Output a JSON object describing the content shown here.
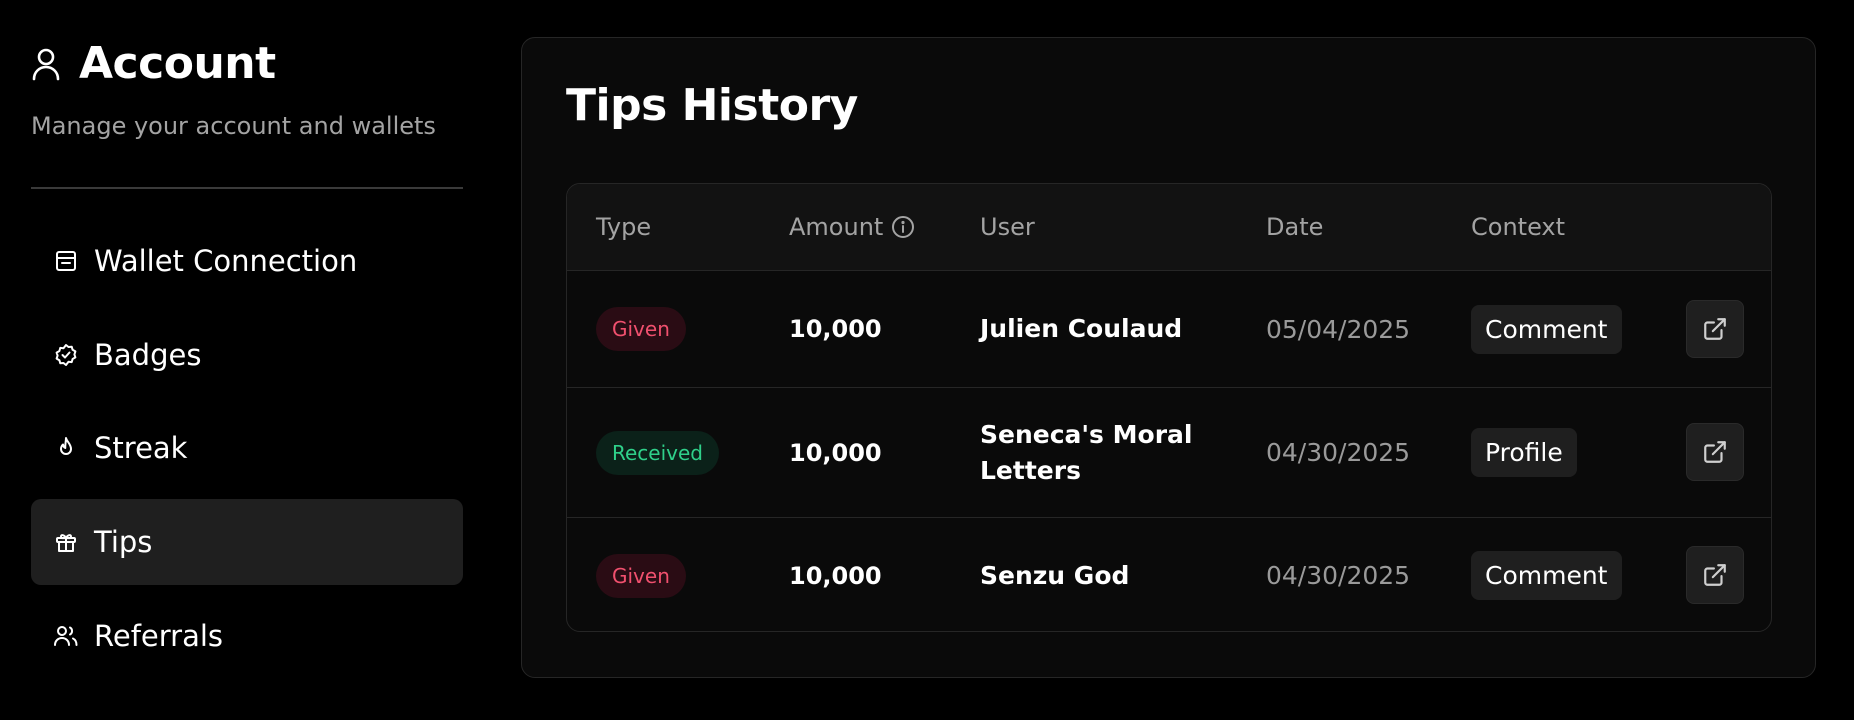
{
  "sidebar": {
    "title": "Account",
    "subtitle": "Manage your account and wallets",
    "items": [
      {
        "label": "Wallet Connection",
        "icon": "wallet-icon"
      },
      {
        "label": "Badges",
        "icon": "badge-check-icon"
      },
      {
        "label": "Streak",
        "icon": "flame-icon"
      },
      {
        "label": "Tips",
        "icon": "gift-icon",
        "active": true
      },
      {
        "label": "Referrals",
        "icon": "users-icon"
      }
    ]
  },
  "main": {
    "title": "Tips History",
    "columns": [
      "Type",
      "Amount",
      "User",
      "Date",
      "Context"
    ],
    "amount_info_icon": "info-icon",
    "rows": [
      {
        "type": "Given",
        "amount": "10,000",
        "user": "Julien Coulaud",
        "date": "05/04/2025",
        "context": "Comment"
      },
      {
        "type": "Received",
        "amount": "10,000",
        "user": "Seneca's Moral Letters",
        "date": "04/30/2025",
        "context": "Profile"
      },
      {
        "type": "Given",
        "amount": "10,000",
        "user": "Senzu God",
        "date": "04/30/2025",
        "context": "Comment"
      }
    ]
  },
  "colors": {
    "background": "#000000",
    "panel": "#0a0a0a",
    "given": "#f0506e",
    "received": "#2fd08a",
    "muted": "#a3a3a3"
  }
}
